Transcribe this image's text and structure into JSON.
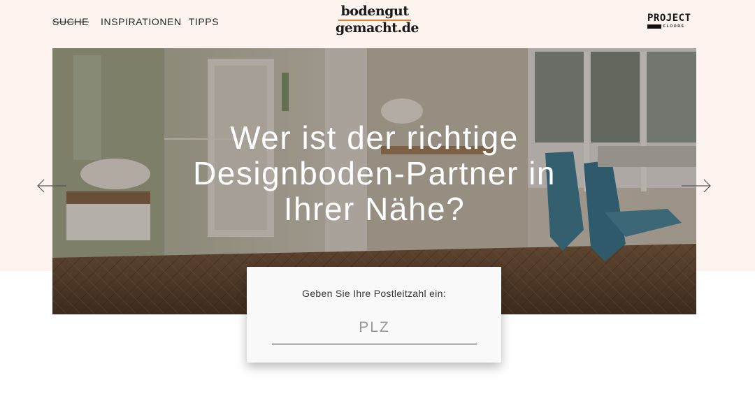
{
  "nav": {
    "items": [
      {
        "label": "SUCHE"
      },
      {
        "label": "INSPIRATIONEN"
      },
      {
        "label": "TIPPS"
      }
    ]
  },
  "logo": {
    "line1": "bodengut",
    "line2": "gemacht.de",
    "accent_color": "#e9782f"
  },
  "brand": {
    "line1": "PROJECT",
    "line2": "FLOORS"
  },
  "hero": {
    "title_line1": "Wer ist der richtige",
    "title_line2": "Designboden-Partner in",
    "title_line3": "Ihrer Nähe?",
    "prev_icon": "arrow-left-icon",
    "next_icon": "arrow-right-icon"
  },
  "search": {
    "label": "Geben Sie Ihre Postleitzahl ein:",
    "placeholder": "PLZ",
    "value": ""
  },
  "colors": {
    "band": "#fdf4ef",
    "text": "#222222",
    "accent": "#e9782f"
  }
}
